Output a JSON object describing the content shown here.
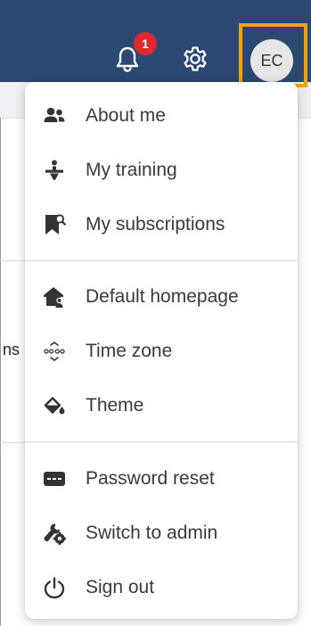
{
  "notifications": {
    "badge_count": "1"
  },
  "user": {
    "initials": "EC"
  },
  "background": {
    "peek_text": "ns"
  },
  "menu": {
    "items": [
      {
        "label": "About me",
        "icon": "users-icon"
      },
      {
        "label": "My training",
        "icon": "trainer-icon"
      },
      {
        "label": "My subscriptions",
        "icon": "bookmark-icon"
      },
      {
        "label": "Default homepage",
        "icon": "home-icon"
      },
      {
        "label": "Time zone",
        "icon": "timezone-icon"
      },
      {
        "label": "Theme",
        "icon": "paint-bucket-icon"
      },
      {
        "label": "Password reset",
        "icon": "password-icon"
      },
      {
        "label": "Switch to admin",
        "icon": "wrench-gear-icon"
      },
      {
        "label": "Sign out",
        "icon": "power-icon"
      }
    ]
  },
  "colors": {
    "topbar": "#2b4872",
    "badge": "#e0292e",
    "focus_ring": "#f5a300"
  }
}
